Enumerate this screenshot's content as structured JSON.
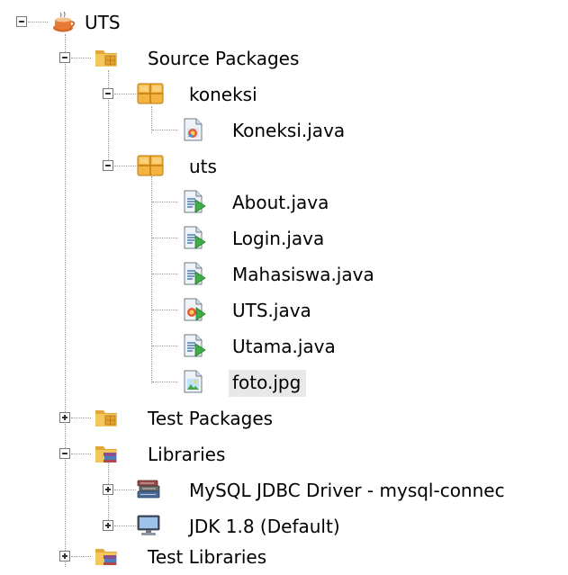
{
  "project": {
    "name": "UTS",
    "nodes": {
      "source_packages": "Source Packages",
      "pkg_koneksi": "koneksi",
      "file_koneksi": "Koneksi.java",
      "pkg_uts": "uts",
      "file_about": "About.java",
      "file_login": "Login.java",
      "file_mahasiswa": "Mahasiswa.java",
      "file_uts": "UTS.java",
      "file_utama": "Utama.java",
      "file_foto": "foto.jpg",
      "test_packages": "Test Packages",
      "libraries": "Libraries",
      "lib_mysql": "MySQL JDBC Driver - mysql-connec",
      "lib_jdk": "JDK 1.8 (Default)",
      "test_libraries": "Test Libraries"
    }
  },
  "icons": {
    "project": "coffee-cup-icon",
    "folder": "package-folder-icon",
    "package": "java-package-icon",
    "java_form": "java-form-file-icon",
    "java_main": "java-main-class-icon",
    "image": "image-file-icon",
    "library": "library-books-icon",
    "jdk": "jdk-monitor-icon"
  },
  "colors": {
    "selection": "#e8e8e8",
    "tree_lines": "#999999",
    "folder": "#e8b54a",
    "package": "#e9a93a"
  }
}
